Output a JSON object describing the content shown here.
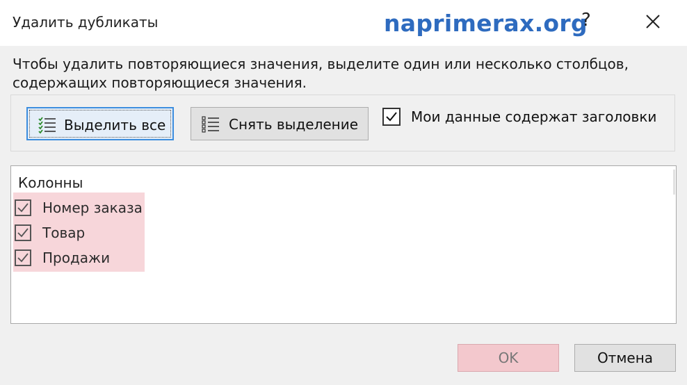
{
  "dialog": {
    "title": "Удалить дубликаты",
    "watermark": "naprimerax.org",
    "help_label": "?",
    "instructions_line1": "Чтобы удалить повторяющиеся значения, выделите один или несколько столбцов,",
    "instructions_line2": "содержащих повторяющиеся значения."
  },
  "toolbar": {
    "select_all_label": "Выделить все",
    "deselect_label": "Снять выделение",
    "headers_checkbox_label": "Мои данные содержат заголовки",
    "headers_checked": true
  },
  "columns": {
    "title": "Колонны",
    "items": [
      {
        "label": "Номер заказа",
        "checked": true
      },
      {
        "label": "Товар",
        "checked": true
      },
      {
        "label": "Продажи",
        "checked": true
      }
    ]
  },
  "footer": {
    "ok_label": "OK",
    "cancel_label": "Отмена"
  },
  "colors": {
    "accent_border": "#3c8dde",
    "highlight": "#f7d6da",
    "watermark": "#2e6bbf"
  },
  "icons": {
    "select_all": "checklist-icon",
    "deselect": "list-icon",
    "close": "close-icon"
  }
}
